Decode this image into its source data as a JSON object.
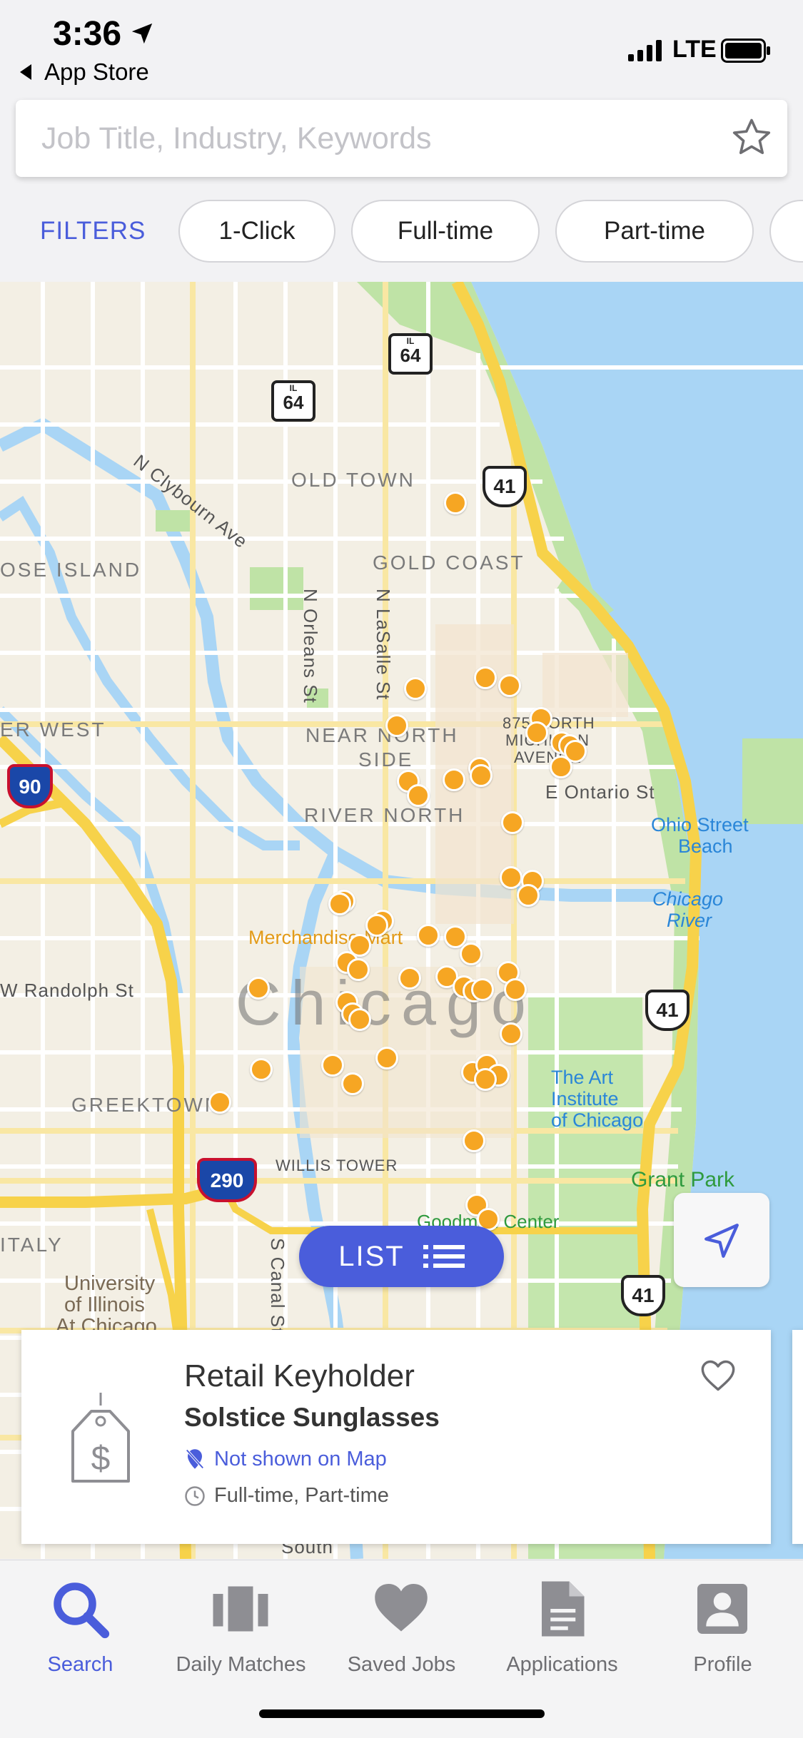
{
  "status_bar": {
    "time": "3:36",
    "back_app": "App Store",
    "network": "LTE"
  },
  "search": {
    "placeholder": "Job Title, Industry, Keywords",
    "value": ""
  },
  "filters": {
    "label": "FILTERS",
    "chips": [
      "1-Click",
      "Full-time",
      "Part-time"
    ]
  },
  "map": {
    "neighborhoods": [
      "OLD TOWN",
      "GOLD COAST",
      "OSE ISLAND",
      "ER WEST",
      "NEAR NORTH",
      "SIDE",
      "RIVER NORTH",
      "GREEKTOWN",
      "ITALY"
    ],
    "city": "Chicago",
    "streets": [
      "N Clybourn Ave",
      "N Orleans St",
      "N LaSalle St",
      "E Ontario St",
      "W Randolph St",
      "S Canal St",
      "South"
    ],
    "landmarks": [
      "875 NORTH",
      "MICHIGAN",
      "AVENUE",
      "WILLIS TOWER",
      "Merchandise Mart",
      "Goodman Center"
    ],
    "water": [
      "Ohio Street",
      "Beach",
      "Chicago",
      "River"
    ],
    "art_institute": [
      "The Art",
      "Institute",
      "of Chicago"
    ],
    "university": [
      "University",
      "of Illinois",
      "At Chicago"
    ],
    "park": "Grant Park",
    "shields": {
      "il64": "64",
      "il": "IL",
      "us41": "41",
      "i90": "90",
      "i290": "290"
    },
    "job_pin_count": 58
  },
  "list_button": {
    "label": "LIST"
  },
  "job_card": {
    "title": "Retail Keyholder",
    "company": "Solstice Sunglasses",
    "map_status": "Not shown on Map",
    "job_type": "Full-time, Part-time"
  },
  "tabs": [
    {
      "label": "Search",
      "icon": "search-icon",
      "active": true
    },
    {
      "label": "Daily Matches",
      "icon": "cards-icon",
      "active": false
    },
    {
      "label": "Saved Jobs",
      "icon": "heart-icon",
      "active": false
    },
    {
      "label": "Applications",
      "icon": "document-icon",
      "active": false
    },
    {
      "label": "Profile",
      "icon": "person-icon",
      "active": false
    }
  ],
  "colors": {
    "accent": "#4a5ddb",
    "pin": "#f6a623",
    "water": "#a9d5f5",
    "park": "#bfe3a6",
    "highway": "#f7d24a"
  }
}
